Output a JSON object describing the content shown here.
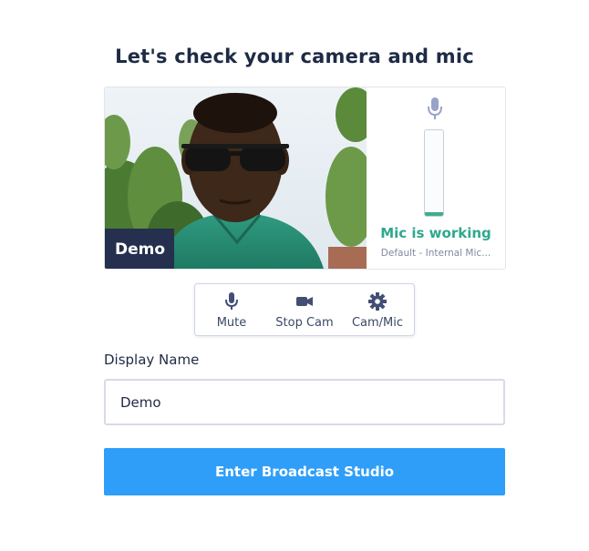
{
  "page": {
    "title": "Let's check your camera and mic"
  },
  "video": {
    "name_tag": "Demo"
  },
  "mic": {
    "status": "Mic is working",
    "device": "Default - Internal Mic...",
    "level": 0.04
  },
  "controls": [
    {
      "label": "Mute",
      "icon": "mic-icon"
    },
    {
      "label": "Stop Cam",
      "icon": "video-camera-icon"
    },
    {
      "label": "Cam/Mic",
      "icon": "gear-icon"
    }
  ],
  "display_name": {
    "label": "Display Name",
    "value": "Demo"
  },
  "enter_button": {
    "label": "Enter Broadcast Studio"
  },
  "colors": {
    "accent": "#2e9ef8",
    "mic_ok": "#2fa88c",
    "dark": "#25304e",
    "icon": "#434e74"
  }
}
